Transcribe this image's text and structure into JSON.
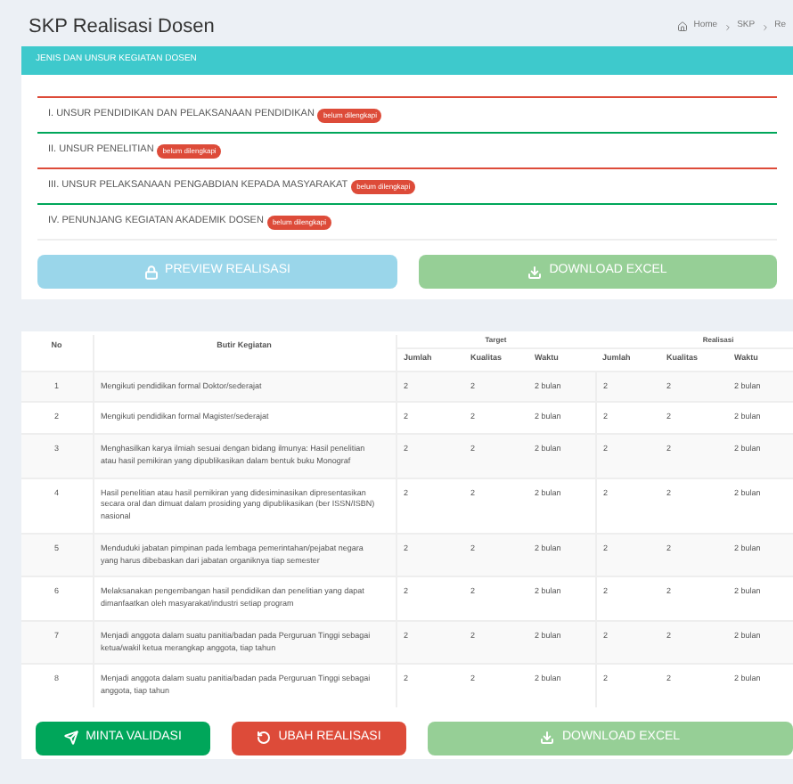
{
  "page": {
    "title": "SKP Realisasi Dosen",
    "breadcrumb": [
      "Home",
      "SKP",
      "Re"
    ]
  },
  "panel": {
    "title": "JENIS DAN UNSUR KEGIATAN DOSEN",
    "items": [
      {
        "label": "I. UNSUR PENDIDIKAN DAN PELAKSANAAN PENDIDIKAN",
        "badge": "belum dilengkapi",
        "color": "#dd4b39"
      },
      {
        "label": "II. UNSUR PENELITIAN",
        "badge": "belum dilengkapi",
        "color": "#00a65a"
      },
      {
        "label": "III. UNSUR PELAKSANAAN PENGABDIAN KEPADA MASYARAKAT",
        "badge": "belum dilengkapi",
        "color": "#dd4b39"
      },
      {
        "label": "IV. PENUNJANG KEGIATAN AKADEMIK DOSEN",
        "badge": "belum dilengkapi",
        "color": "#00a65a"
      }
    ],
    "buttons": [
      {
        "label": "PREVIEW REALISASI",
        "kind": "preview",
        "disabled": true
      },
      {
        "label": "DOWNLOAD EXCEL",
        "kind": "download",
        "disabled": true
      }
    ]
  },
  "table": {
    "columns": {
      "no": "No",
      "activity": "Butir Kegiatan",
      "groups": [
        "Target",
        "Realisasi"
      ],
      "sub": [
        "Jumlah",
        "Kualitas",
        "Waktu",
        "Jumlah",
        "Kualitas",
        "Waktu"
      ]
    },
    "rows": [
      {
        "no": "1",
        "activity": "Mengikuti pendidikan formal Doktor/sederajat",
        "values": [
          "2",
          "2",
          "2 bulan",
          "2",
          "2",
          "2 bulan"
        ]
      },
      {
        "no": "2",
        "activity": "Mengikuti pendidikan formal Magister/sederajat",
        "values": [
          "2",
          "2",
          "2 bulan",
          "2",
          "2",
          "2 bulan"
        ]
      },
      {
        "no": "3",
        "activity": "Menghasilkan karya ilmiah sesuai dengan bidang ilmunya: Hasil penelitian atau hasil pemikiran yang dipublikasikan dalam bentuk buku Monograf",
        "values": [
          "2",
          "2",
          "2 bulan",
          "2",
          "2",
          "2 bulan"
        ]
      },
      {
        "no": "4",
        "activity": "Hasil penelitian atau hasil pemikiran yang didesiminasikan dipresentasikan secara oral dan dimuat dalam prosiding yang dipublikasikan (ber ISSN/ISBN) nasional",
        "values": [
          "2",
          "2",
          "2 bulan",
          "2",
          "2",
          "2 bulan"
        ]
      },
      {
        "no": "5",
        "activity": "Menduduki jabatan pimpinan pada lembaga pemerintahan/pejabat negara yang harus dibebaskan dari jabatan organiknya tiap semester",
        "values": [
          "2",
          "2",
          "2 bulan",
          "2",
          "2",
          "2 bulan"
        ]
      },
      {
        "no": "6",
        "activity": "Melaksanakan pengembangan hasil pendidikan dan penelitian yang dapat dimanfaatkan oleh masyarakat/industri setiap program",
        "values": [
          "2",
          "2",
          "2 bulan",
          "2",
          "2",
          "2 bulan"
        ]
      },
      {
        "no": "7",
        "activity": "Menjadi anggota dalam suatu panitia/badan pada Perguruan Tinggi sebagai ketua/wakil ketua merangkap anggota, tiap tahun",
        "values": [
          "2",
          "2",
          "2 bulan",
          "2",
          "2",
          "2 bulan"
        ]
      },
      {
        "no": "8",
        "activity": "Menjadi anggota dalam suatu panitia/badan pada Perguruan Tinggi sebagai anggota, tiap tahun",
        "values": [
          "2",
          "2",
          "2 bulan",
          "2",
          "2",
          "2 bulan"
        ]
      }
    ]
  },
  "actions": [
    {
      "label": "MINTA VALIDASI",
      "kind": "request",
      "disabled": false
    },
    {
      "label": "UBAH REALISASI",
      "kind": "edit",
      "disabled": false
    },
    {
      "label": "DOWNLOAD EXCEL",
      "kind": "download",
      "disabled": true
    }
  ]
}
